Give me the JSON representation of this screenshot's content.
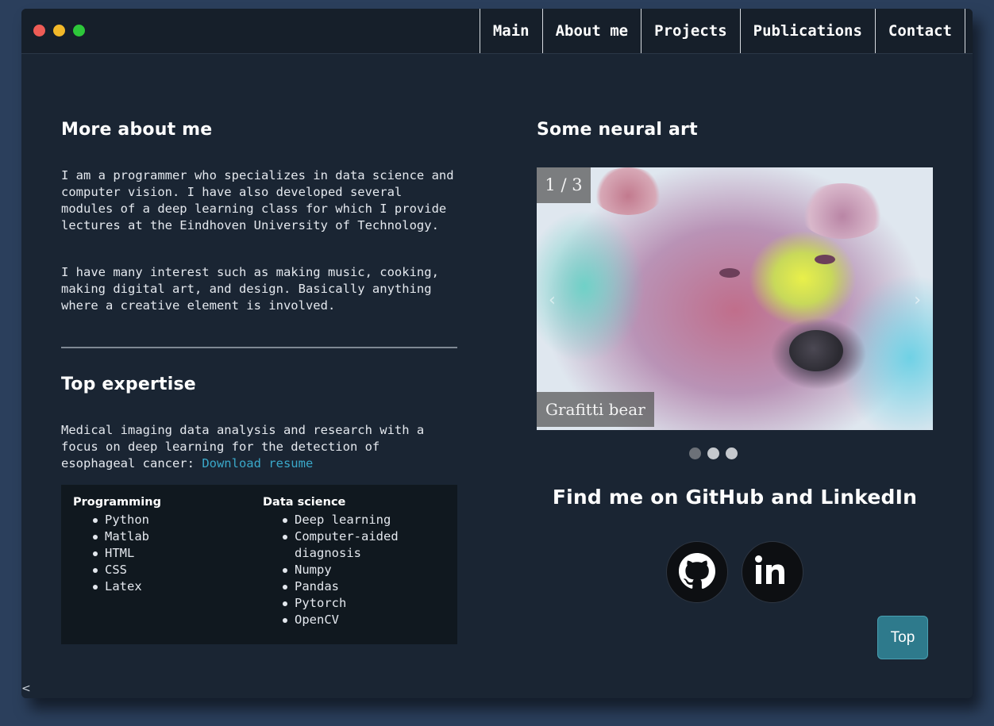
{
  "nav": {
    "items": [
      "Main",
      "About me",
      "Projects",
      "Publications",
      "Contact"
    ]
  },
  "about": {
    "title": "More about me",
    "paragraph1": "I am a programmer who specializes in data science and computer vision. I have also developed several modules of a deep learning class for which I provide lectures at the Eindhoven University of Technology.",
    "paragraph2": "I have many interest such as making music, cooking, making digital art, and design. Basically anything where a creative element is involved."
  },
  "expertise": {
    "title": "Top expertise",
    "text": "Medical imaging data analysis and research with a focus on deep learning for the detection of esophageal cancer: ",
    "resume_link": "Download resume",
    "programming": {
      "title": "Programming",
      "items": [
        "Python",
        "Matlab",
        "HTML",
        "CSS",
        "Latex"
      ]
    },
    "data_science": {
      "title": "Data science",
      "items": [
        "Deep learning",
        "Computer-aided diagnosis",
        "Numpy",
        "Pandas",
        "Pytorch",
        "OpenCV"
      ]
    }
  },
  "art": {
    "title": "Some neural art",
    "counter": "1 / 3",
    "caption": "Grafitti bear",
    "prev_icon": "‹",
    "next_icon": "›",
    "slide_count": 3,
    "active_slide": 1
  },
  "social": {
    "title": "Find me on GitHub and LinkedIn",
    "github_icon": "github-icon",
    "linkedin_icon": "linkedin-icon"
  },
  "top_button": "Top",
  "corner_glyph": "<",
  "colors": {
    "background": "#1a2533",
    "accent_link": "#3aa8c9",
    "top_button": "#2e7a8c"
  }
}
